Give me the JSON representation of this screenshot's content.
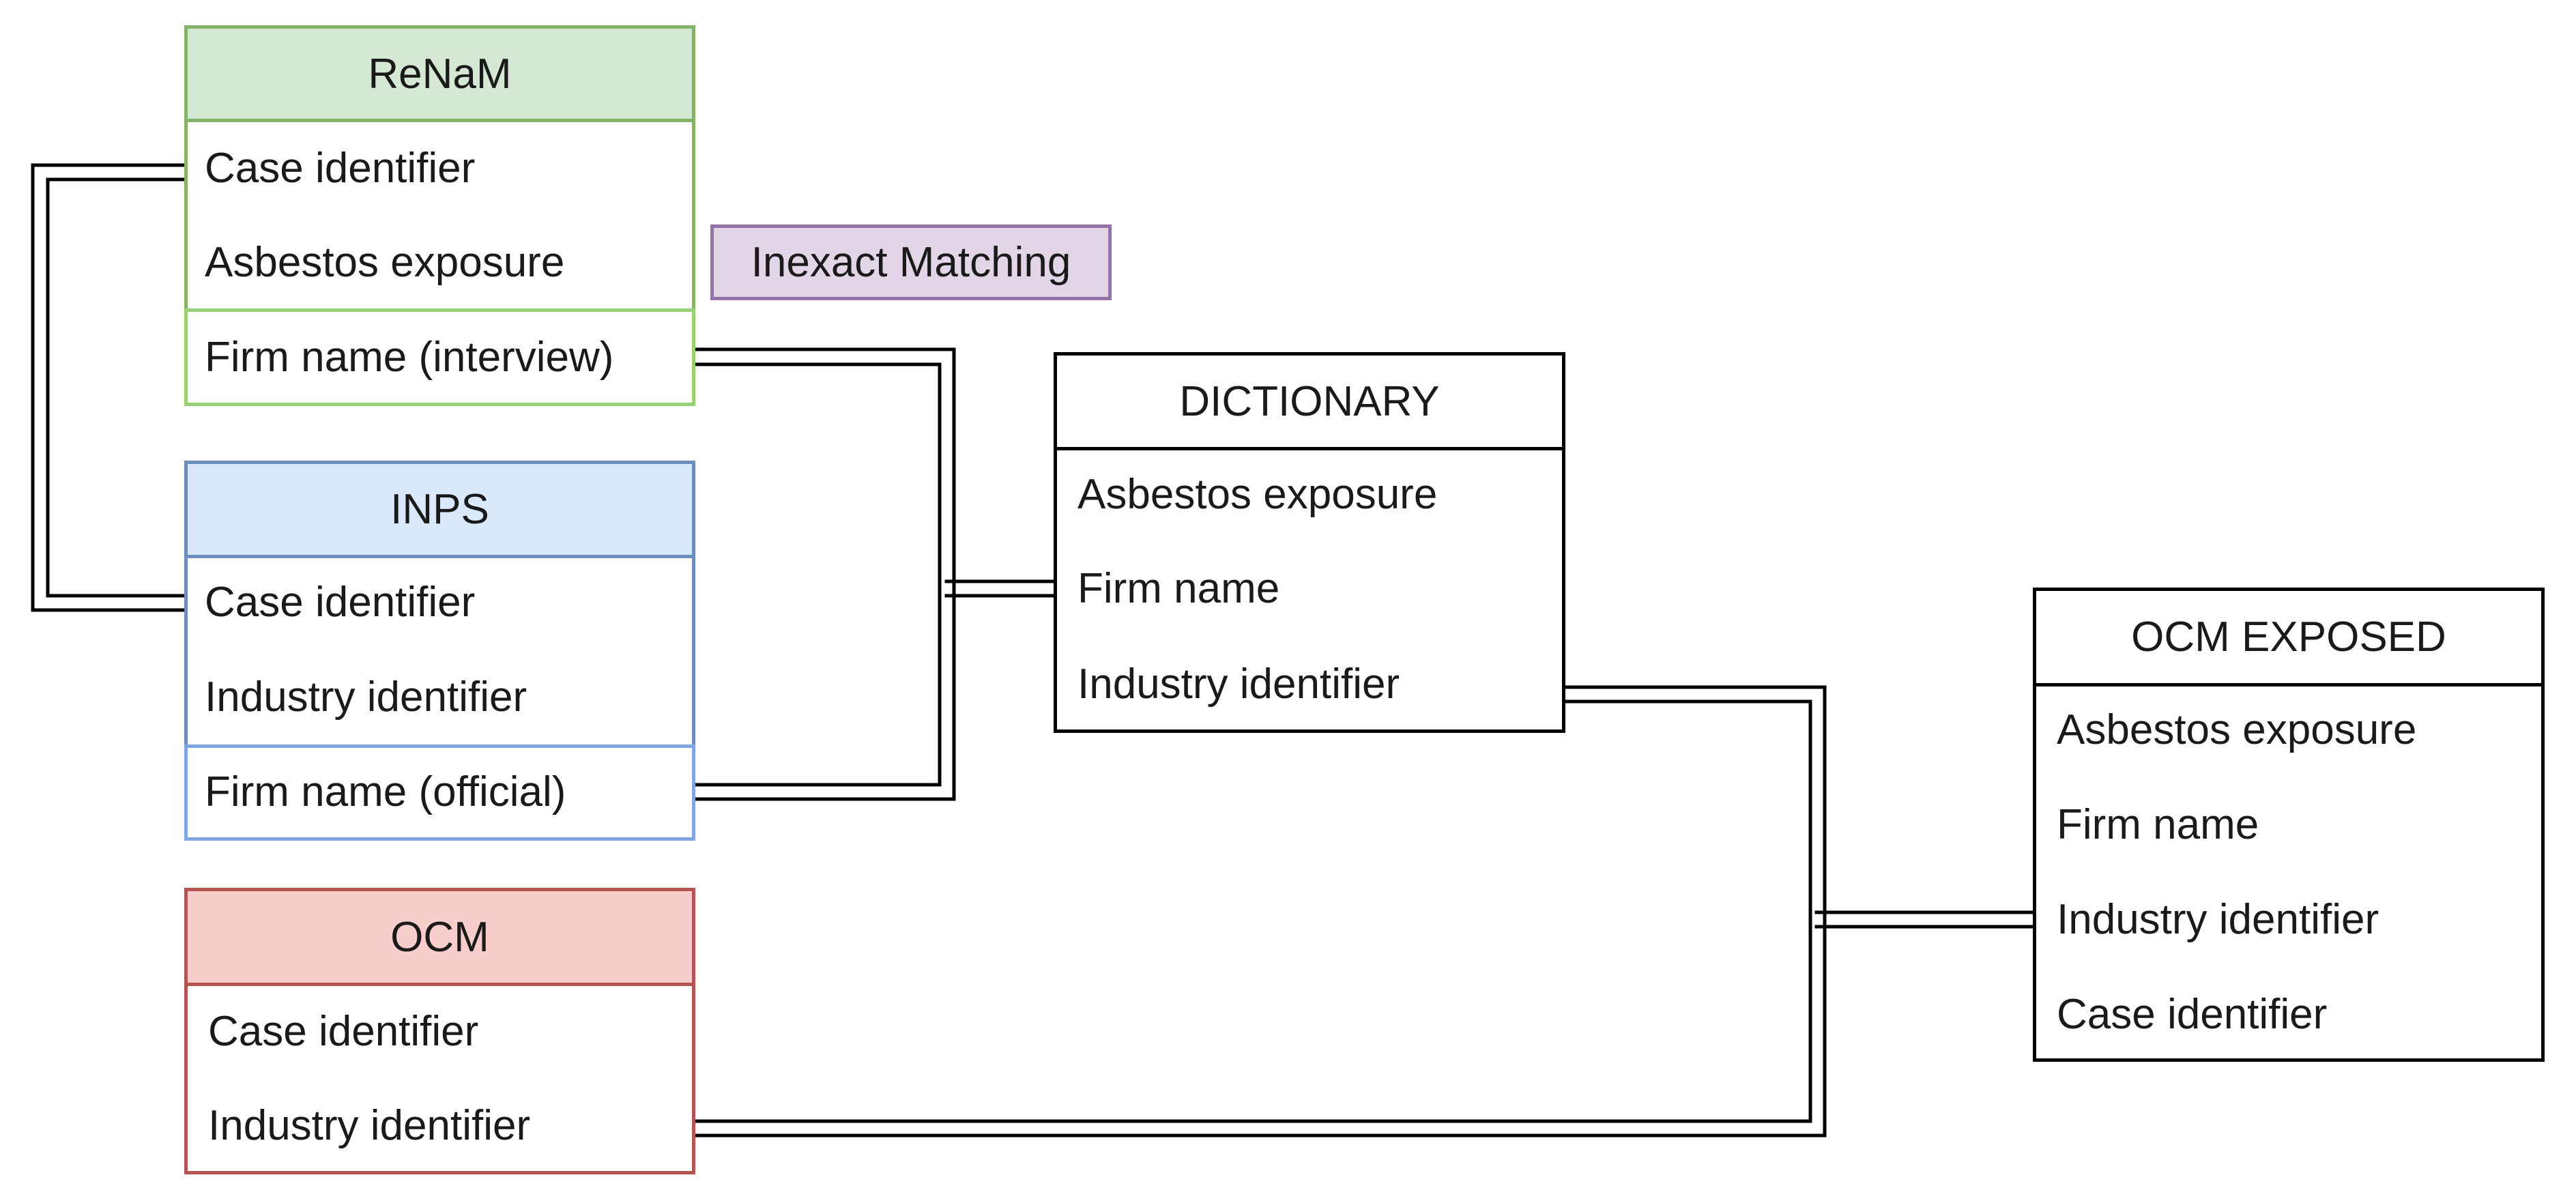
{
  "diagram": {
    "entities": {
      "renam": {
        "title": "ReNaM",
        "fields": [
          "Case identifier",
          "Asbestos exposure"
        ],
        "lower_fields": [
          "Firm name (interview)"
        ],
        "colors": {
          "fill": "#D5E8D4",
          "stroke": "#82B366",
          "lower_stroke": "#97D077"
        }
      },
      "inps": {
        "title": "INPS",
        "fields": [
          "Case identifier",
          "Industry identifier"
        ],
        "lower_fields": [
          "Firm name (official)"
        ],
        "colors": {
          "fill": "#DAE8FC",
          "stroke": "#6C8EBF",
          "lower_stroke": "#7EA6E0"
        }
      },
      "ocm": {
        "title": "OCM",
        "fields": [
          "Case identifier",
          "Industry identifier"
        ],
        "colors": {
          "fill": "#F8CECC",
          "stroke": "#B85450"
        }
      },
      "dictionary": {
        "title": "DICTIONARY",
        "fields": [
          "Asbestos exposure",
          "Firm name",
          "Industry identifier"
        ],
        "colors": {
          "fill": "#FFFFFF",
          "stroke": "#000000"
        }
      },
      "ocm_exposed": {
        "title": "OCM EXPOSED",
        "fields": [
          "Asbestos exposure",
          "Firm name",
          "Industry identifier",
          "Case identifier"
        ],
        "colors": {
          "fill": "#FFFFFF",
          "stroke": "#000000"
        }
      }
    },
    "notes": {
      "inexact_matching": {
        "label": "Inexact Matching",
        "colors": {
          "fill": "#E1D5E7",
          "stroke": "#9673A6"
        }
      }
    },
    "connectors": [
      {
        "from": "ReNaM.Case identifier",
        "to": "INPS.Case identifier",
        "style": "double-line"
      },
      {
        "from": "ReNaM.Firm name (interview)",
        "to": "DICTIONARY.Firm name",
        "style": "double-line"
      },
      {
        "from": "INPS.Firm name (official)",
        "to": "DICTIONARY.Firm name",
        "style": "double-line"
      },
      {
        "from": "DICTIONARY.Industry identifier",
        "to": "OCM EXPOSED.Industry identifier",
        "style": "double-line"
      },
      {
        "from": "OCM.Industry identifier",
        "to": "OCM EXPOSED.Industry identifier",
        "style": "double-line"
      }
    ]
  }
}
